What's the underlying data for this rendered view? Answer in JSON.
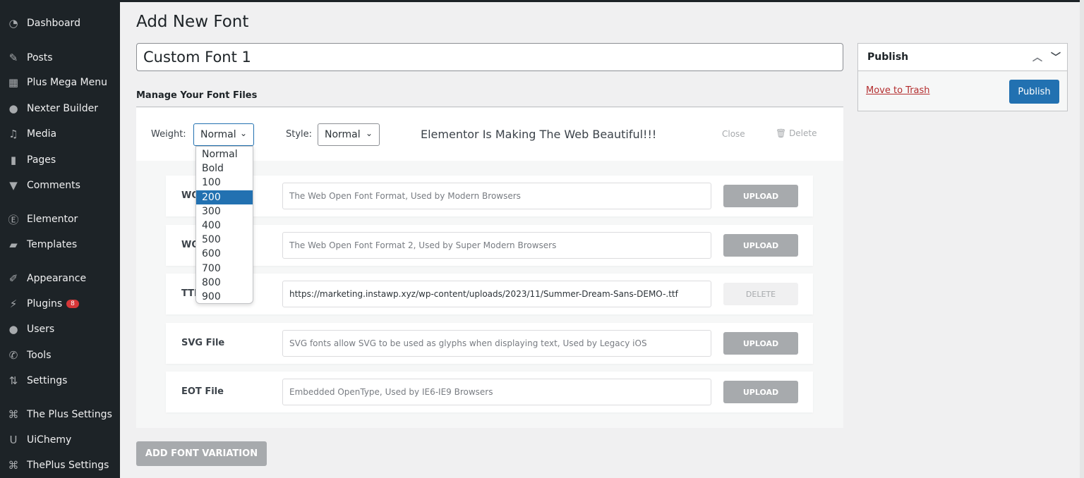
{
  "sidebar": {
    "items": [
      {
        "label": "Dashboard",
        "icon": "dashboard-icon",
        "glyph": "◔"
      },
      {
        "label": "Posts",
        "icon": "pin-icon",
        "glyph": "✎"
      },
      {
        "label": "Plus Mega Menu",
        "icon": "menu-grid-icon",
        "glyph": "▦"
      },
      {
        "label": "Nexter Builder",
        "icon": "info-circle-icon",
        "glyph": "●"
      },
      {
        "label": "Media",
        "icon": "media-icon",
        "glyph": "♫"
      },
      {
        "label": "Pages",
        "icon": "pages-icon",
        "glyph": "▮"
      },
      {
        "label": "Comments",
        "icon": "comment-icon",
        "glyph": "▼"
      },
      {
        "label": "Elementor",
        "icon": "elementor-icon",
        "glyph": "Ⓔ"
      },
      {
        "label": "Templates",
        "icon": "folder-icon",
        "glyph": "▰"
      },
      {
        "label": "Appearance",
        "icon": "paintbrush-icon",
        "glyph": "✐"
      },
      {
        "label": "Plugins",
        "icon": "plugin-icon",
        "glyph": "⚡",
        "badge": "8"
      },
      {
        "label": "Users",
        "icon": "user-icon",
        "glyph": "●"
      },
      {
        "label": "Tools",
        "icon": "wrench-icon",
        "glyph": "✆"
      },
      {
        "label": "Settings",
        "icon": "settings-icon",
        "glyph": "⇅"
      },
      {
        "label": "The Plus Settings",
        "icon": "theplus-icon",
        "glyph": "⌘"
      },
      {
        "label": "UiChemy",
        "icon": "uichemy-icon",
        "glyph": "U"
      },
      {
        "label": "ThePlus Settings",
        "icon": "theplus-icon",
        "glyph": "⌘"
      }
    ]
  },
  "page": {
    "title": "Add New Font",
    "font_name": "Custom Font 1",
    "section": "Manage Your Font Files"
  },
  "variation": {
    "weight_label": "Weight:",
    "weight_value": "Normal",
    "style_label": "Style:",
    "style_value": "Normal",
    "preview": "Elementor Is Making The Web Beautiful!!!",
    "close": "Close",
    "delete": "Delete",
    "weight_options": [
      "Normal",
      "Bold",
      "100",
      "200",
      "300",
      "400",
      "500",
      "600",
      "700",
      "800",
      "900"
    ],
    "weight_highlighted": "200"
  },
  "files": [
    {
      "label": "WOFF File",
      "placeholder": "The Web Open Font Format, Used by Modern Browsers",
      "value": "",
      "button": "UPLOAD"
    },
    {
      "label": "WOFF2 File",
      "placeholder": "The Web Open Font Format 2, Used by Super Modern Browsers",
      "value": "",
      "button": "UPLOAD"
    },
    {
      "label": "TTF File",
      "placeholder": "",
      "value": "https://marketing.instawp.xyz/wp-content/uploads/2023/11/Summer-Dream-Sans-DEMO-.ttf",
      "button": "DELETE"
    },
    {
      "label": "SVG File",
      "placeholder": "SVG fonts allow SVG to be used as glyphs when displaying text, Used by Legacy iOS",
      "value": "",
      "button": "UPLOAD"
    },
    {
      "label": "EOT File",
      "placeholder": "Embedded OpenType, Used by IE6-IE9 Browsers",
      "value": "",
      "button": "UPLOAD"
    }
  ],
  "add_variation": "ADD FONT VARIATION",
  "publish": {
    "title": "Publish",
    "trash": "Move to Trash",
    "button": "Publish"
  },
  "colors": {
    "sidebar": "#1d2327",
    "primary": "#2271b1",
    "trash": "#b32d2e",
    "badge": "#d63638"
  }
}
